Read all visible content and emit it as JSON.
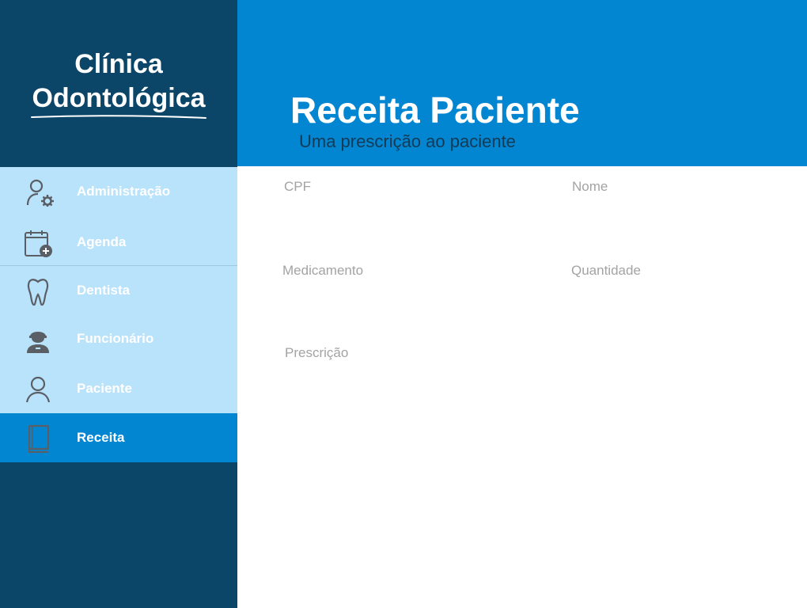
{
  "brand": {
    "line1": "Clínica",
    "line2": "Odontológica"
  },
  "sidebar": {
    "items": [
      {
        "label": "Administração",
        "icon": "admin-user-gear-icon"
      },
      {
        "label": "Agenda",
        "icon": "calendar-add-icon"
      },
      {
        "label": "Dentista",
        "icon": "tooth-icon"
      },
      {
        "label": "Funcionário",
        "icon": "employee-icon"
      },
      {
        "label": "Paciente",
        "icon": "patient-user-icon"
      },
      {
        "label": "Receita",
        "icon": "prescription-book-icon",
        "active": true
      }
    ]
  },
  "header": {
    "title": "Receita Paciente",
    "subtitle": "Uma prescrição ao paciente"
  },
  "form": {
    "cpf": {
      "label": "CPF",
      "value": ""
    },
    "nome": {
      "label": "Nome",
      "value": ""
    },
    "medicamento": {
      "label": "Medicamento",
      "value": ""
    },
    "quantidade": {
      "label": "Quantidade",
      "value": ""
    },
    "prescricao": {
      "label": "Prescrição",
      "value": ""
    }
  },
  "colors": {
    "sidebar_dark": "#0b4568",
    "menu_light": "#b9e2fb",
    "accent_blue": "#0286d2",
    "subtitle_text": "#143a55",
    "field_label": "#a3a3a3",
    "icon_gray": "#5a5f66"
  }
}
